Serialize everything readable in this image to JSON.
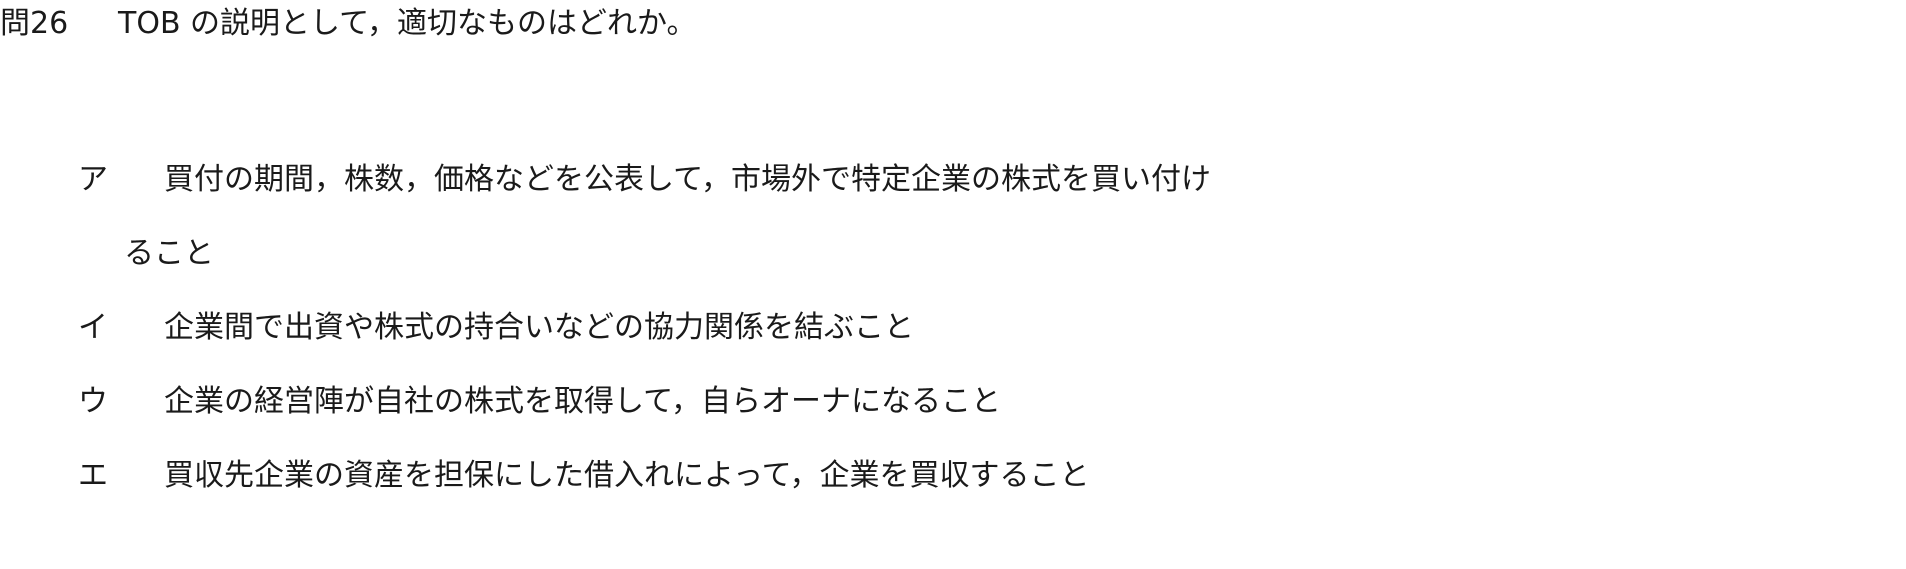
{
  "question": {
    "number": "問26",
    "text": "TOB の説明として，適切なものはどれか。"
  },
  "options": [
    {
      "label": "ア",
      "text": "買付の期間，株数，価格などを公表して，市場外で特定企業の株式を買い付け",
      "continuation": "ること"
    },
    {
      "label": "イ",
      "text": "企業間で出資や株式の持合いなどの協力関係を結ぶこと"
    },
    {
      "label": "ウ",
      "text": "企業の経営陣が自社の株式を取得して，自らオーナになること"
    },
    {
      "label": "エ",
      "text": "買収先企業の資産を担保にした借入れによって，企業を買収すること"
    }
  ]
}
